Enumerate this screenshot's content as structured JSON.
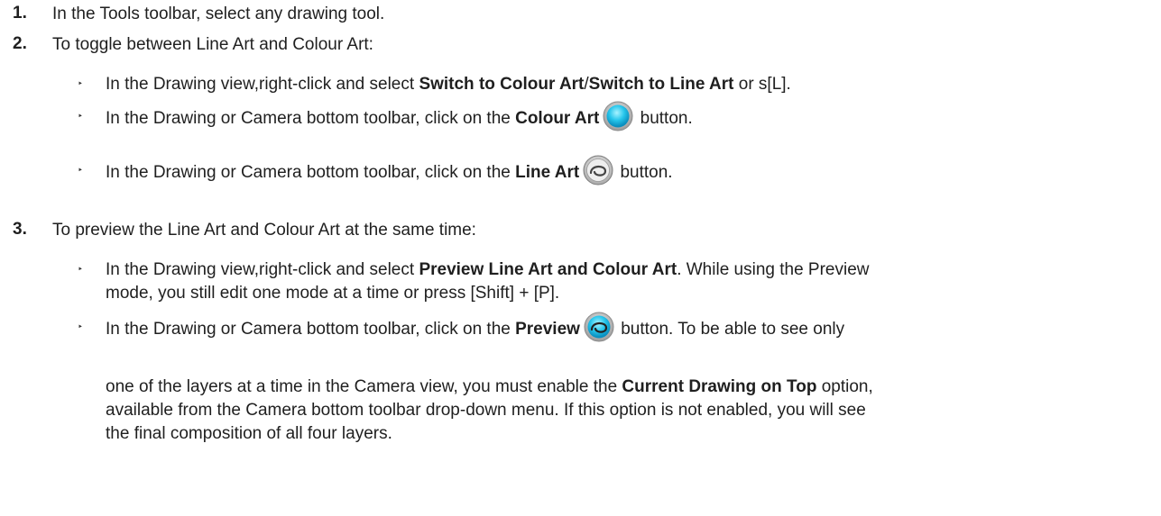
{
  "steps": [
    {
      "num": "1.",
      "text": "In the Tools toolbar, select any drawing tool."
    },
    {
      "num": "2.",
      "text": "To toggle between Line Art and Colour Art:"
    },
    {
      "num": "3.",
      "text": "To preview the Line Art and Colour Art at the same time:"
    }
  ],
  "step2_bullets": {
    "b1": {
      "pre": "In the Drawing view,right-click and select ",
      "bold1": "Switch to Colour Art",
      "mid": "/",
      "bold2": "Switch to Line Art",
      "post": " or s[L]."
    },
    "b2": {
      "pre": "In the Drawing or Camera bottom toolbar, click on the ",
      "bold": "Colour Art",
      "post": " button."
    },
    "b3": {
      "pre": "In the Drawing or Camera bottom toolbar, click on the ",
      "bold": "Line Art",
      "post": " button."
    }
  },
  "step3_bullets": {
    "b1": {
      "pre": "In the Drawing view,right-click and select ",
      "bold": "Preview Line Art and Colour Art",
      "post": ". While using the Preview",
      "line2": "mode, you still edit one mode at a time or press [Shift] + [P]."
    },
    "b2": {
      "pre": "In the Drawing or Camera bottom toolbar, click on the ",
      "bold": "Preview",
      "post": " button. To be able to see only"
    },
    "cont": {
      "pre": "one of the layers at a time in the Camera view, you must enable the ",
      "bold": "Current Drawing on Top",
      "post": " option,",
      "line2": "available from the Camera bottom toolbar drop-down menu. If this option is not enabled, you will see",
      "line3": "the final composition of all four layers."
    }
  },
  "bullet_glyph": "‣",
  "icons": {
    "colour_art": "colour-art-icon",
    "line_art": "line-art-icon",
    "preview": "preview-icon"
  }
}
